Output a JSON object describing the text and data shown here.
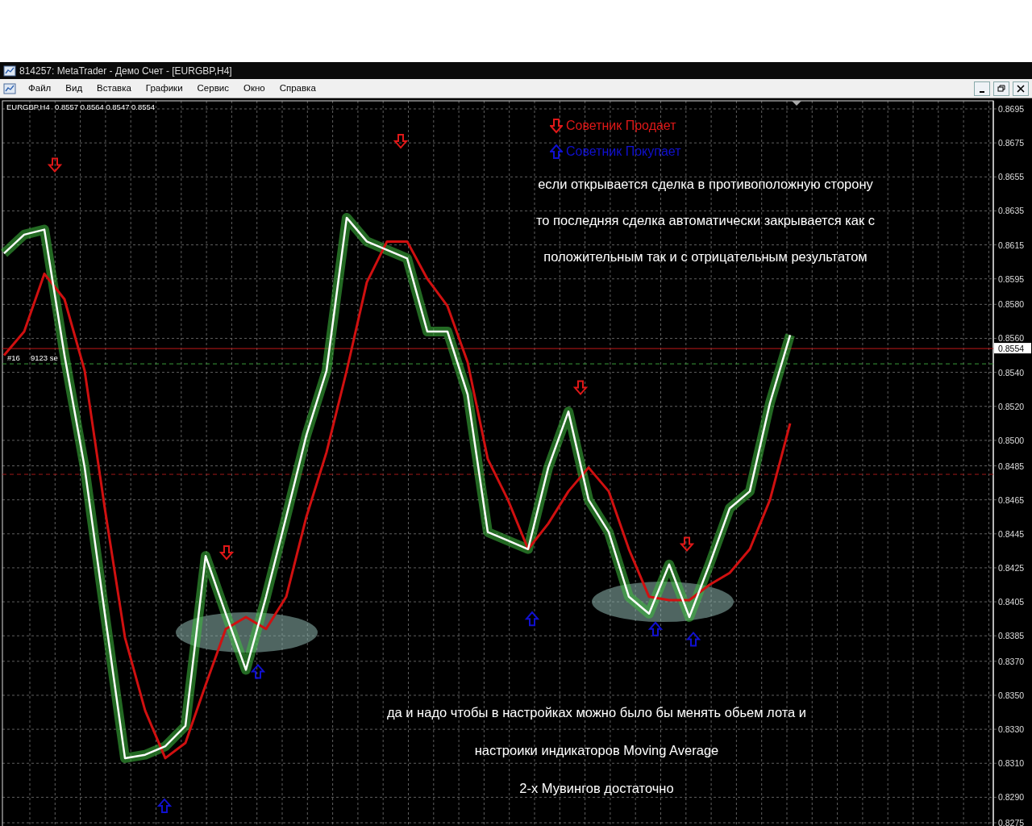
{
  "window": {
    "title": "814257: MetaTrader - Демо Счет - [EURGBP,H4]"
  },
  "menu": {
    "items": [
      "Файл",
      "Вид",
      "Вставка",
      "Графики",
      "Сервис",
      "Окно",
      "Справка"
    ]
  },
  "chart": {
    "symbol": "EURGBP,H4",
    "ohlc": "0.8557 0.8564 0.8547 0.8554",
    "y_axis_labels": [
      "0.8695",
      "0.8675",
      "0.8655",
      "0.8635",
      "0.8615",
      "0.8595",
      "0.8580",
      "0.8560",
      "0.8540",
      "0.8520",
      "0.8500",
      "0.8485",
      "0.8465",
      "0.8445",
      "0.8425",
      "0.8405",
      "0.8385",
      "0.8370",
      "0.8350",
      "0.8330",
      "0.8310",
      "0.8290",
      "0.8275"
    ],
    "price_label": "0.8554",
    "order_label": [
      "#16",
      "9123 se"
    ],
    "legend": [
      {
        "kind": "sell",
        "label": "Советник Продает",
        "color": "#e01818"
      },
      {
        "kind": "buy",
        "label": "Советник Покупает",
        "color": "#1010d0"
      }
    ],
    "notes_top": [
      "если открывается сделка в противоположную сторону",
      "то последняя сделка автоматически закрывается как с",
      "положительным так и с отрицательным результатом"
    ],
    "notes_bottom": [
      "да и надо чтобы в настройках можно было бы менять обьем лота и",
      "настроики индикаторов Moving Average",
      "2-х Мувингов достаточно"
    ]
  }
}
